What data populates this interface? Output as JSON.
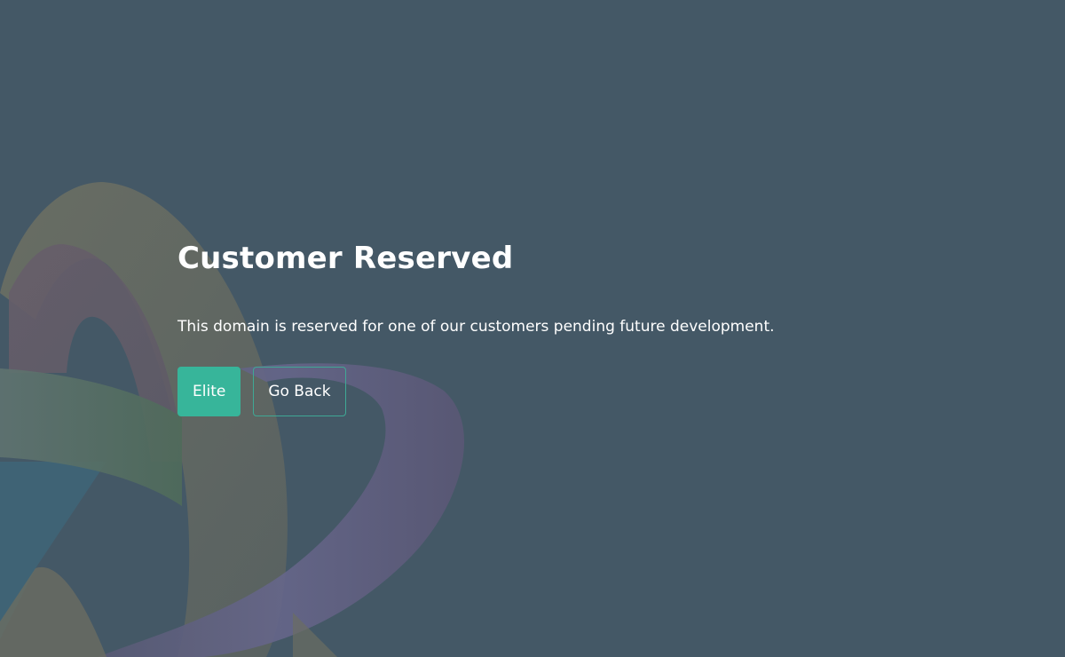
{
  "page": {
    "title": "Customer Reserved",
    "message": "This domain is reserved for one of our customers pending future development."
  },
  "actions": {
    "primary_label": "Elite",
    "secondary_label": "Go Back"
  },
  "colors": {
    "background": "#445866",
    "accent": "#37b59a",
    "text": "#ffffff"
  }
}
